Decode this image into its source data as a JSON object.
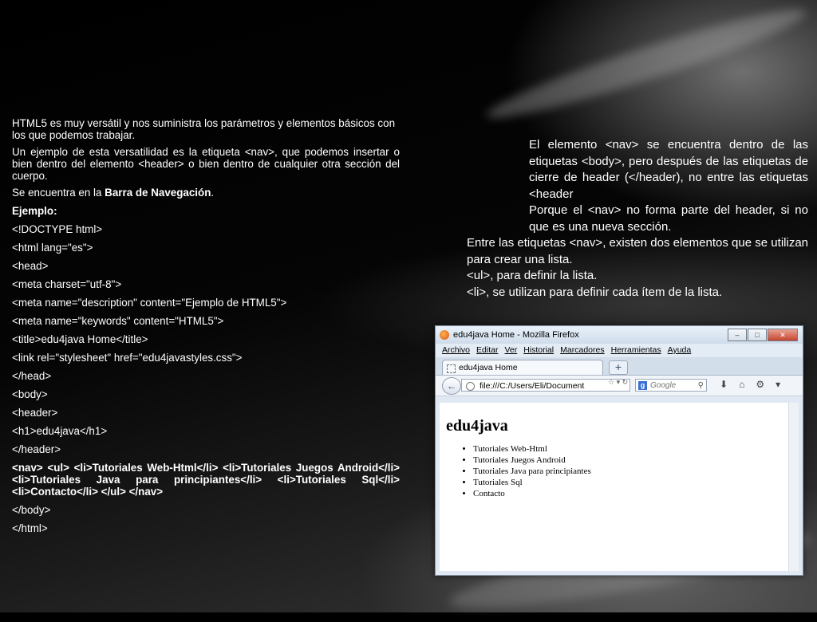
{
  "left": {
    "intro1": "HTML5 es muy versátil y nos suministra los parámetros y elementos básicos con los que podemos trabajar.",
    "intro2": "Un ejemplo de esta versatilidad es la etiqueta <nav>, que podemos insertar o bien dentro del elemento <header> o bien dentro de cualquier otra sección del cuerpo.",
    "location_prefix": "Se encuentra en la",
    "location_bold": "Barra de Navegación",
    "location_suffix": ".",
    "example_label": "Ejemplo:",
    "code_lines": [
      "<!DOCTYPE html>",
      "<html lang=\"es\">",
      "<head>",
      "<meta charset=\"utf-8\">",
      "<meta name=\"description\" content=\"Ejemplo de HTML5\">",
      "<meta name=\"keywords\" content=\"HTML5\">",
      "<title>edu4java Home</title>",
      "<link rel=\"stylesheet\" href=\"edu4javastyles.css\">",
      "</head>",
      "<body>",
      "<header>",
      "<h1>edu4java</h1>",
      "</header>"
    ],
    "nav_line": "<nav> <ul> <li>Tutoriales Web-Html</li> <li>Tutoriales Juegos Android</li> <li>Tutoriales Java para principiantes</li> <li>Tutoriales Sql</li> <li>Contacto</li> </ul> </nav>",
    "code_end": [
      "</body>",
      "</html>"
    ]
  },
  "right": {
    "p1": "El elemento <nav> se encuentra dentro de las etiquetas <body>, pero después de las etiquetas de cierre de header (</header), no entre las etiquetas <header",
    "p2": "Porque el <nav> no forma parte del header, si no que es una nueva sección.",
    "p3": "Entre las etiquetas <nav>, existen dos elementos que se utilizan para crear una lista.",
    "p4": "<ul>, para definir la lista.",
    "p5": "<li>, se utilizan para definir cada ítem de la lista."
  },
  "browser": {
    "window_title": "edu4java Home - Mozilla Firefox",
    "menu": [
      "Archivo",
      "Editar",
      "Ver",
      "Historial",
      "Marcadores",
      "Herramientas",
      "Ayuda"
    ],
    "tab_title": "edu4java Home",
    "new_tab": "+",
    "url": "file:///C:/Users/Eli/Document",
    "search_placeholder": "Google",
    "page_heading": "edu4java",
    "list_items": [
      "Tutoriales Web-Html",
      "Tutoriales Juegos Android",
      "Tutoriales Java para principiantes",
      "Tutoriales Sql",
      "Contacto"
    ]
  }
}
